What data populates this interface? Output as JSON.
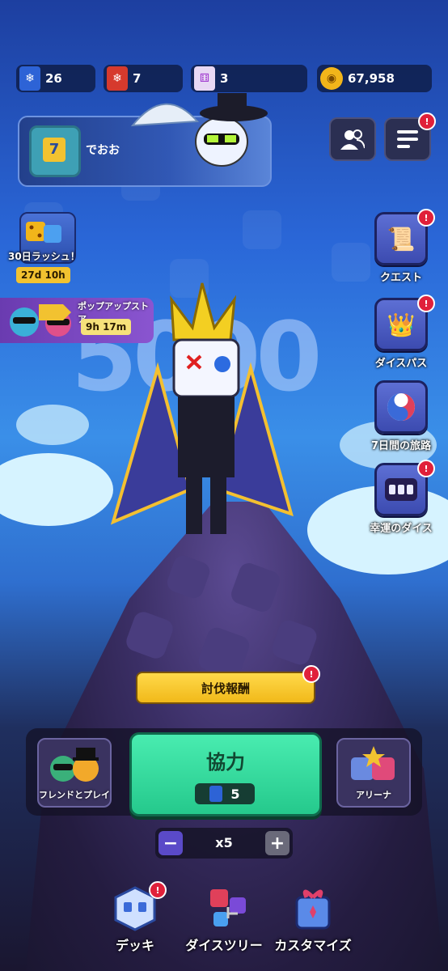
{
  "currencies": [
    {
      "icon": "blue-ticket-icon",
      "value": "26"
    },
    {
      "icon": "red-ticket-icon",
      "value": "7"
    },
    {
      "icon": "dice-icon",
      "value": "3"
    },
    {
      "icon": "gold-coin-icon",
      "value": "67,958"
    }
  ],
  "profile": {
    "name": "でおお",
    "level_icon": "dice-level-icon"
  },
  "events": {
    "rush": {
      "label": "30日ラッシュ！",
      "timer": "27d 10h"
    },
    "popup_store": {
      "label": "ポップアップストア",
      "timer": "9h 17m"
    }
  },
  "side_menu": [
    {
      "label": "クエスト",
      "icon": "scroll-icon"
    },
    {
      "label": "ダイスパス",
      "icon": "crown-icon"
    },
    {
      "label": "7日間の旅路",
      "icon": "compass-icon"
    },
    {
      "label": "幸運のダイス",
      "icon": "lucky-dice-icon"
    }
  ],
  "hero": {
    "score": "5000"
  },
  "reward_button": "討伐報酬",
  "modes": {
    "friend_play": "フレンドとプレイ",
    "coop": "協力",
    "coop_cost": "5",
    "arena": "アリーナ"
  },
  "multiplier": {
    "value": "x5",
    "minus": "−",
    "plus": "+"
  },
  "bottom_nav": [
    {
      "label": "デッキ"
    },
    {
      "label": "ダイスツリー"
    },
    {
      "label": "カスタマイズ"
    }
  ],
  "colors": {
    "accent_green": "#2fd79a",
    "gold": "#f2c230",
    "badge_red": "#e0203a"
  }
}
